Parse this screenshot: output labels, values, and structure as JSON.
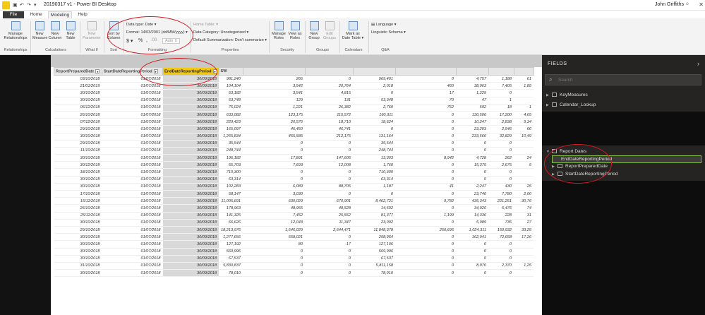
{
  "window": {
    "title": "20190317 v1 - Power BI Desktop",
    "user": "John Griffiths",
    "controls": [
      "—",
      "□",
      "✕"
    ]
  },
  "tabs": [
    "File",
    "Home",
    "Modeling",
    "Help"
  ],
  "ribbon": {
    "relationships": {
      "manage_l1": "Manage",
      "manage_l2": "Relationships",
      "group": "Relationships"
    },
    "calculations": {
      "new_measure_l1": "New",
      "new_measure_l2": "Measure",
      "new_column_l1": "New",
      "new_column_l2": "Column",
      "new_table_l1": "New",
      "new_table_l2": "Table",
      "group": "Calculations"
    },
    "whatif": {
      "new_param_l1": "New",
      "new_param_l2": "Parameter",
      "group": "What If"
    },
    "sort": {
      "sort_l1": "Sort by",
      "sort_l2": "Column",
      "group": "Sort"
    },
    "formatting": {
      "data_type": "Data type: Date",
      "format": "Format: 14/03/2001 (dd/MM/yyyy)",
      "currency": "$",
      "percent": "%",
      "comma": ",",
      "decimals": ".00",
      "auto": "Auto",
      "group": "Formatting"
    },
    "properties": {
      "home_table": "Home Table:",
      "data_category": "Data Category: Uncategorized",
      "default_summarization": "Default Summarization: Don't summarize",
      "group": "Properties"
    },
    "security": {
      "manage_roles_l1": "Manage",
      "manage_roles_l2": "Roles",
      "view_as_l1": "View as",
      "view_as_l2": "Roles",
      "group": "Security"
    },
    "groups": {
      "new_group_l1": "New",
      "new_group_l2": "Group",
      "edit_groups_l1": "Edit",
      "edit_groups_l2": "Groups",
      "group": "Groups"
    },
    "calendars": {
      "mark_l1": "Mark as",
      "mark_l2": "Date Table",
      "group": "Calendars"
    },
    "qa": {
      "language": "Language",
      "linguistic": "Linguistic Schema",
      "group": "Q&A"
    }
  },
  "table": {
    "headers": [
      "ReportPreparedDate",
      "StartDateReportingPeriod",
      "EndDateReportingPeriod",
      "SW",
      "",
      "",
      "",
      "",
      "",
      "",
      ""
    ],
    "rows": [
      [
        "03/10/2018",
        "01/07/2018",
        "30/09/2018",
        "981,240",
        "266",
        "0",
        "969,401",
        "0",
        "4,757",
        "1,188",
        "61"
      ],
      [
        "21/01/2019",
        "01/07/2018",
        "30/09/2018",
        "104,104",
        "3,542",
        "20,764",
        "2,018",
        "460",
        "38,963",
        "7,405",
        "1,85"
      ],
      [
        "30/10/2018",
        "01/07/2018",
        "30/09/2018",
        "53,182",
        "3,541",
        "4,815",
        "0",
        "17",
        "1,229",
        "0",
        ""
      ],
      [
        "30/10/2018",
        "01/07/2018",
        "30/09/2018",
        "53,748",
        "129",
        "131",
        "53,348",
        "70",
        "47",
        "1",
        ""
      ],
      [
        "06/12/2018",
        "01/07/2018",
        "30/09/2018",
        "75,024",
        "1,221",
        "26,382",
        "2,760",
        "752",
        "592",
        "18",
        "1"
      ],
      [
        "26/10/2018",
        "01/07/2018",
        "30/09/2018",
        "633,082",
        "123,175",
        "115,572",
        "160,911",
        "0",
        "130,506",
        "17,200",
        "4,65"
      ],
      [
        "07/12/2018",
        "01/07/2018",
        "30/09/2018",
        "229,423",
        "20,576",
        "18,710",
        "18,624",
        "0",
        "10,247",
        "2,838",
        "9,34"
      ],
      [
        "29/10/2018",
        "01/07/2018",
        "30/09/2018",
        "165,097",
        "46,450",
        "46,741",
        "0",
        "0",
        "23,203",
        "2,546",
        "66"
      ],
      [
        "30/10/2018",
        "01/07/2018",
        "30/09/2018",
        "1,265,834",
        "455,585",
        "212,175",
        "131,164",
        "0",
        "233,560",
        "32,829",
        "10,49"
      ],
      [
        "29/10/2018",
        "01/07/2018",
        "30/09/2018",
        "35,544",
        "0",
        "0",
        "35,544",
        "0",
        "0",
        "0",
        ""
      ],
      [
        "11/10/2018",
        "01/07/2018",
        "30/09/2018",
        "248,744",
        "0",
        "0",
        "248,744",
        "0",
        "0",
        "0",
        ""
      ],
      [
        "30/10/2018",
        "01/07/2018",
        "30/09/2018",
        "196,182",
        "17,891",
        "147,605",
        "13,303",
        "8,942",
        "4,728",
        "262",
        "24"
      ],
      [
        "30/12/2018",
        "01/07/2018",
        "30/09/2018",
        "55,703",
        "7,693",
        "12,008",
        "1,760",
        "0",
        "15,375",
        "2,675",
        "5"
      ],
      [
        "18/10/2018",
        "01/07/2018",
        "30/09/2018",
        "710,300",
        "0",
        "0",
        "710,300",
        "0",
        "0",
        "0",
        ""
      ],
      [
        "30/10/2018",
        "01/07/2018",
        "30/09/2018",
        "63,314",
        "0",
        "0",
        "63,314",
        "0",
        "0",
        "0",
        ""
      ],
      [
        "30/10/2018",
        "01/07/2018",
        "30/09/2018",
        "102,283",
        "6,089",
        "88,705",
        "1,187",
        "41",
        "2,247",
        "430",
        "25"
      ],
      [
        "17/10/2018",
        "01/07/2018",
        "30/09/2018",
        "58,147",
        "3,030",
        "0",
        "0",
        "0",
        "23,740",
        "7,780",
        "2,00"
      ],
      [
        "15/11/2018",
        "01/07/2018",
        "30/09/2018",
        "11,005,691",
        "630,029",
        "670,901",
        "8,462,721",
        "9,782",
        "435,343",
        "221,251",
        "30,76"
      ],
      [
        "26/10/2018",
        "01/07/2018",
        "30/09/2018",
        "178,963",
        "48,955",
        "48,528",
        "14,592",
        "0",
        "34,026",
        "5,476",
        "74"
      ],
      [
        "25/11/2018",
        "01/07/2018",
        "30/09/2018",
        "141,325",
        "7,452",
        "25,552",
        "81,377",
        "1,199",
        "14,336",
        "228",
        "31"
      ],
      [
        "30/10/2018",
        "01/07/2018",
        "30/09/2018",
        "66,626",
        "12,043",
        "11,347",
        "23,092",
        "0",
        "5,989",
        "735",
        "27"
      ],
      [
        "29/10/2018",
        "01/07/2018",
        "30/09/2018",
        "18,213,976",
        "1,646,029",
        "2,644,471",
        "11,848,378",
        "250,695",
        "1,024,311",
        "150,932",
        "33,25"
      ],
      [
        "30/10/2018",
        "01/07/2018",
        "30/09/2018",
        "1,277,656",
        "558,021",
        "0",
        "298,954",
        "0",
        "162,041",
        "72,658",
        "17,26"
      ],
      [
        "30/10/2018",
        "01/07/2018",
        "30/09/2018",
        "127,192",
        "80",
        "17",
        "127,106",
        "0",
        "0",
        "0",
        ""
      ],
      [
        "30/10/2018",
        "01/07/2018",
        "30/09/2018",
        "569,996",
        "0",
        "0",
        "569,996",
        "0",
        "0",
        "0",
        ""
      ],
      [
        "30/10/2018",
        "01/07/2018",
        "30/09/2018",
        "67,537",
        "0",
        "0",
        "67,537",
        "0",
        "0",
        "0",
        ""
      ],
      [
        "31/10/2018",
        "01/07/2018",
        "30/09/2018",
        "5,830,837",
        "0",
        "0",
        "5,811,158",
        "0",
        "8,070",
        "2,370",
        "1,25"
      ],
      [
        "30/10/2018",
        "01/07/2018",
        "30/09/2018",
        "78,010",
        "0",
        "0",
        "78,010",
        "0",
        "0",
        "0",
        ""
      ]
    ]
  },
  "fields": {
    "title": "FIELDS",
    "search_placeholder": "Search",
    "tables": [
      {
        "name": "KeyMeasures"
      },
      {
        "name": "Calendar_Lookup"
      }
    ],
    "report_dates": {
      "name": "Report Dates",
      "items": [
        "EndDateReportingPeriod",
        "ReportPreparedDate",
        "StartDateReportingPeriod"
      ]
    }
  },
  "colors": {
    "accent": "#F2C811",
    "annotation": "#D71920",
    "pane": "#252423"
  }
}
